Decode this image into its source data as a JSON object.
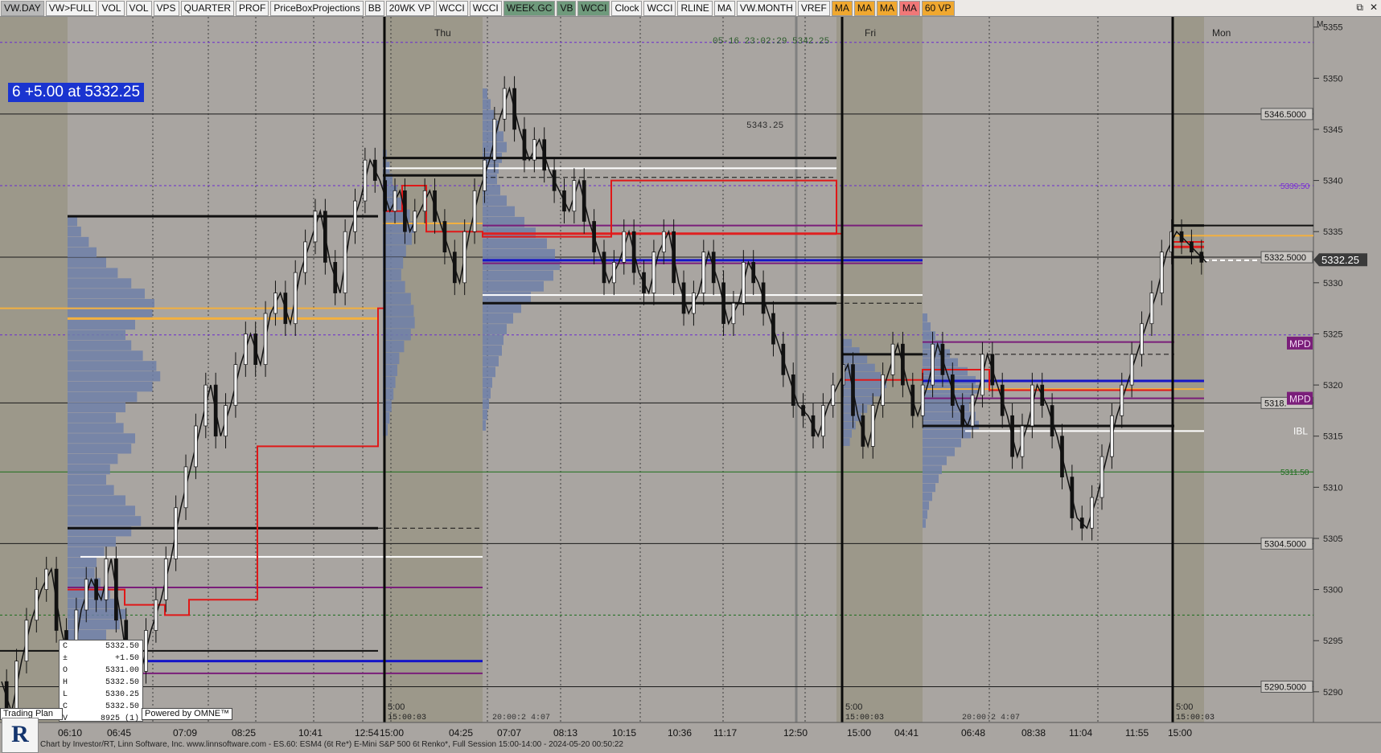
{
  "toolbar": {
    "buttons": [
      {
        "label": "VW.DAY",
        "bg": "#b9b9b9"
      },
      {
        "label": "VW>FULL",
        "bg": "#f3f3f3"
      },
      {
        "label": "VOL",
        "bg": "#f3f3f3"
      },
      {
        "label": "VOL",
        "bg": "#f3f3f3"
      },
      {
        "label": "VPS",
        "bg": "#f3f3f3"
      },
      {
        "label": "QUARTER",
        "bg": "#f3f3f3"
      },
      {
        "label": "PROF",
        "bg": "#f3f3f3"
      },
      {
        "label": "PriceBoxProjections",
        "bg": "#f3f3f3"
      },
      {
        "label": "BB",
        "bg": "#f3f3f3"
      },
      {
        "label": "20WK VP",
        "bg": "#f3f3f3"
      },
      {
        "label": "WCCI",
        "bg": "#f3f3f3"
      },
      {
        "label": "WCCI",
        "bg": "#f3f3f3"
      },
      {
        "label": "WEEK.GC",
        "bg": "#6f9a7c"
      },
      {
        "label": "VB",
        "bg": "#6f9a7c"
      },
      {
        "label": "WCCI",
        "bg": "#6f9a7c"
      },
      {
        "label": "Clock",
        "bg": "#f3f3f3"
      },
      {
        "label": "WCCI",
        "bg": "#f3f3f3"
      },
      {
        "label": "RLINE",
        "bg": "#f3f3f3"
      },
      {
        "label": "MA",
        "bg": "#f3f3f3"
      },
      {
        "label": "VW.MONTH",
        "bg": "#f3f3f3"
      },
      {
        "label": "VREF",
        "bg": "#f3f3f3"
      },
      {
        "label": "MA",
        "bg": "#f0a830"
      },
      {
        "label": "MA",
        "bg": "#f0a830"
      },
      {
        "label": "MA",
        "bg": "#f0a830"
      },
      {
        "label": "MA",
        "bg": "#f07878"
      },
      {
        "label": "60 VP",
        "bg": "#f0a830"
      }
    ]
  },
  "signal": "6  +5.00 at 5332.25",
  "quote": {
    "rows": [
      {
        "k": "C",
        "v": "5332.50"
      },
      {
        "k": "±",
        "v": "+1.50"
      },
      {
        "k": "O",
        "v": "5331.00"
      },
      {
        "k": "H",
        "v": "5332.50"
      },
      {
        "k": "L",
        "v": "5330.25"
      },
      {
        "k": "C",
        "v": "5332.50"
      },
      {
        "k": "V",
        "v": "8925 (1)"
      }
    ]
  },
  "trading_plan": "Trading Plan",
  "omne": "Powered by OMNE™",
  "logo": "R",
  "footer": "Chart by Investor/RT, Linn Software, Inc. www.linnsoftware.com - ES.60: ESM4 (6t Re*) E-Mini S&P 500 6t Renko*, Full Session 15:00-14:00 - 2024-05-20 00:50:22",
  "chart_data": {
    "type": "line",
    "instrument": "ES.60: ESM4 (6t Re*) E-Mini S&P 500 6t Renko*",
    "ylim": [
      5287,
      5356
    ],
    "y_ticks": [
      5290,
      5295,
      5300,
      5305,
      5310,
      5315,
      5320,
      5325,
      5330,
      5335,
      5340,
      5345,
      5350,
      5355
    ],
    "y_tick_labels": [
      "5290",
      "5295",
      "5300",
      "5305",
      "5310",
      "5315",
      "5320",
      "5325",
      "5330",
      "5335",
      "5340",
      "5345",
      "5350",
      "5355"
    ],
    "x_tick_labels": [
      "06:10",
      "06:45",
      "07:09",
      "08:25",
      "10:41",
      "12:54",
      "15:00",
      "04:25",
      "07:07",
      "08:13",
      "10:15",
      "10:36",
      "11:17",
      "12:50",
      "15:00",
      "04:41",
      "06:48",
      "08:38",
      "11:04",
      "11:55",
      "15:00"
    ],
    "day_labels": [
      "Thu",
      "Fri",
      "Mon"
    ],
    "session_labels": [
      "5:00",
      "5:00",
      "5:00"
    ],
    "session_stamps": [
      "15:00:03",
      "15:00:03",
      "15:00:03"
    ],
    "session_stamp_text": [
      "20:00:2 4:07",
      "20:00:2 4:07"
    ],
    "annotations": [
      "05-16 23:02:29  5342.25",
      "5343.25"
    ],
    "price_labels": [
      {
        "text": "5346.5000",
        "y": 5346.5
      },
      {
        "text": "5332.5000",
        "y": 5332.5
      },
      {
        "text": "5318.",
        "y": 5318.25
      },
      {
        "text": "5304.5000",
        "y": 5304.5
      },
      {
        "text": "5290.5000",
        "y": 5290.5
      }
    ],
    "level_labels": [
      {
        "text": "5339.50",
        "y": 5339.5,
        "color": "#7a2ad8"
      },
      {
        "text": "5311.50",
        "y": 5311.5,
        "color": "#1b6e1b"
      },
      {
        "text": "MPD",
        "y": 5324.1,
        "color": "#7a1e7a"
      },
      {
        "text": "MPD",
        "y": 5318.7,
        "color": "#7a1e7a"
      },
      {
        "text": "IBL",
        "y": 5315.5,
        "color": "#ffffff"
      }
    ],
    "last_price": {
      "text": "5332.25",
      "y": 5332.25
    },
    "series": [
      {
        "name": "Price",
        "values": [
          5291,
          5288,
          5293,
          5297,
          5300,
          5302,
          5296,
          5292,
          5298,
          5301,
          5299,
          5303,
          5297,
          5290,
          5292,
          5296,
          5299,
          5303,
          5308,
          5312,
          5316,
          5320,
          5315,
          5318,
          5322,
          5325,
          5322,
          5327,
          5329,
          5326,
          5331,
          5334,
          5337,
          5332,
          5329,
          5335,
          5338,
          5342,
          5340,
          5337,
          5339,
          5335,
          5337,
          5339,
          5336,
          5333,
          5330,
          5335,
          5339,
          5342,
          5346,
          5349,
          5345,
          5342,
          5344,
          5341,
          5339,
          5337,
          5340,
          5336,
          5333,
          5330,
          5332,
          5335,
          5331,
          5329,
          5333,
          5335,
          5330,
          5327,
          5329,
          5333,
          5330,
          5326,
          5328,
          5332,
          5330,
          5327,
          5324,
          5321,
          5318,
          5317,
          5315,
          5318,
          5320,
          5322,
          5317,
          5314,
          5318,
          5321,
          5324,
          5320,
          5317,
          5320,
          5324,
          5321,
          5318,
          5316,
          5319,
          5323,
          5320,
          5317,
          5313,
          5316,
          5320,
          5318,
          5315,
          5311,
          5307,
          5306,
          5309,
          5313,
          5317,
          5320,
          5323,
          5326,
          5329,
          5333,
          5335,
          5334,
          5333,
          5332
        ]
      }
    ]
  }
}
